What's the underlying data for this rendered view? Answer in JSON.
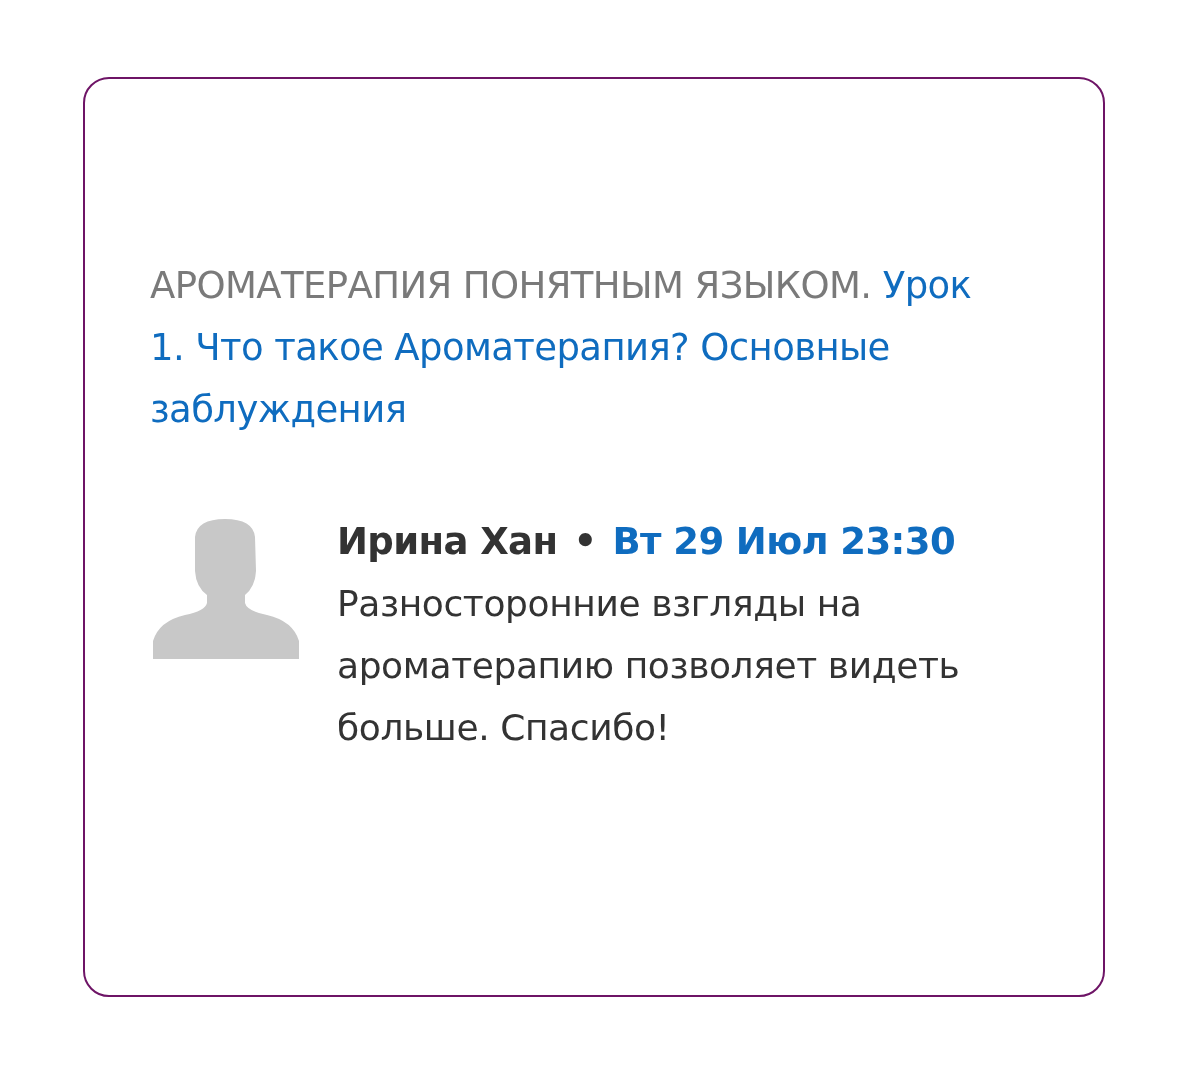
{
  "card": {
    "heading": {
      "course": "АРОМАТЕРАПИЯ ПОНЯТНЫМ ЯЗЫКОМ.",
      "lesson": "Урок 1. Что такое Ароматерапия? Основные заблуждения"
    },
    "post": {
      "author": "Ирина Хан",
      "separator": "•",
      "date": "Вт 29 Июл 23:30",
      "message": "Разносторонние взгляды на ароматерапию позволяет видеть больше. Спасибо!"
    }
  }
}
